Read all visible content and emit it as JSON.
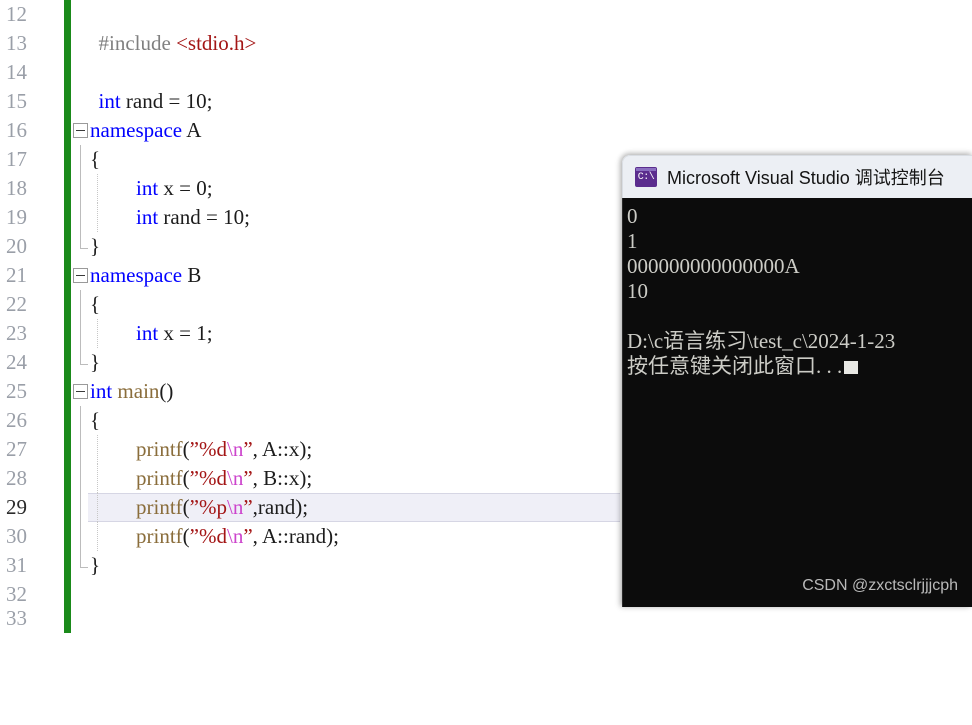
{
  "editor": {
    "gutter_change_color": "#1a8a1a",
    "current_line": 29,
    "lines": [
      {
        "no": "12",
        "fold": "none"
      },
      {
        "no": "13",
        "fold": "none"
      },
      {
        "no": "14",
        "fold": "none"
      },
      {
        "no": "15",
        "fold": "none"
      },
      {
        "no": "16",
        "fold": "collapse"
      },
      {
        "no": "17",
        "fold": "none"
      },
      {
        "no": "18",
        "fold": "none"
      },
      {
        "no": "19",
        "fold": "none"
      },
      {
        "no": "20",
        "fold": "none"
      },
      {
        "no": "21",
        "fold": "collapse"
      },
      {
        "no": "22",
        "fold": "none"
      },
      {
        "no": "23",
        "fold": "none"
      },
      {
        "no": "24",
        "fold": "none"
      },
      {
        "no": "25",
        "fold": "collapse"
      },
      {
        "no": "26",
        "fold": "none"
      },
      {
        "no": "27",
        "fold": "none"
      },
      {
        "no": "28",
        "fold": "none"
      },
      {
        "no": "29",
        "fold": "none"
      },
      {
        "no": "30",
        "fold": "none"
      },
      {
        "no": "31",
        "fold": "none"
      },
      {
        "no": "32",
        "fold": "none"
      },
      {
        "no": "33",
        "fold": "none"
      }
    ],
    "source_text": [
      "",
      "#include <stdio.h>",
      "",
      "int rand = 10;",
      "namespace A",
      "{",
      "    int x = 0;",
      "    int rand = 10;",
      "}",
      "namespace B",
      "{",
      "    int x = 1;",
      "}",
      "int main()",
      "{",
      "    printf(\"%d\\n\", A::x);",
      "    printf(\"%d\\n\", B::x);",
      "    printf(\"%p\\n\",rand);",
      "    printf(\"%d\\n\", A::rand);",
      "}",
      "",
      ""
    ]
  },
  "console": {
    "title": "Microsoft Visual Studio 调试控制台",
    "icon": "cmd-icon",
    "icon_glyph": "C:\\",
    "output": [
      "0",
      "1",
      "000000000000000A",
      "10",
      "",
      "D:\\c语言练习\\test_c\\2024-1-23",
      "按任意键关闭此窗口. . ."
    ],
    "watermark": "CSDN @zxctsclrjjjcph"
  }
}
